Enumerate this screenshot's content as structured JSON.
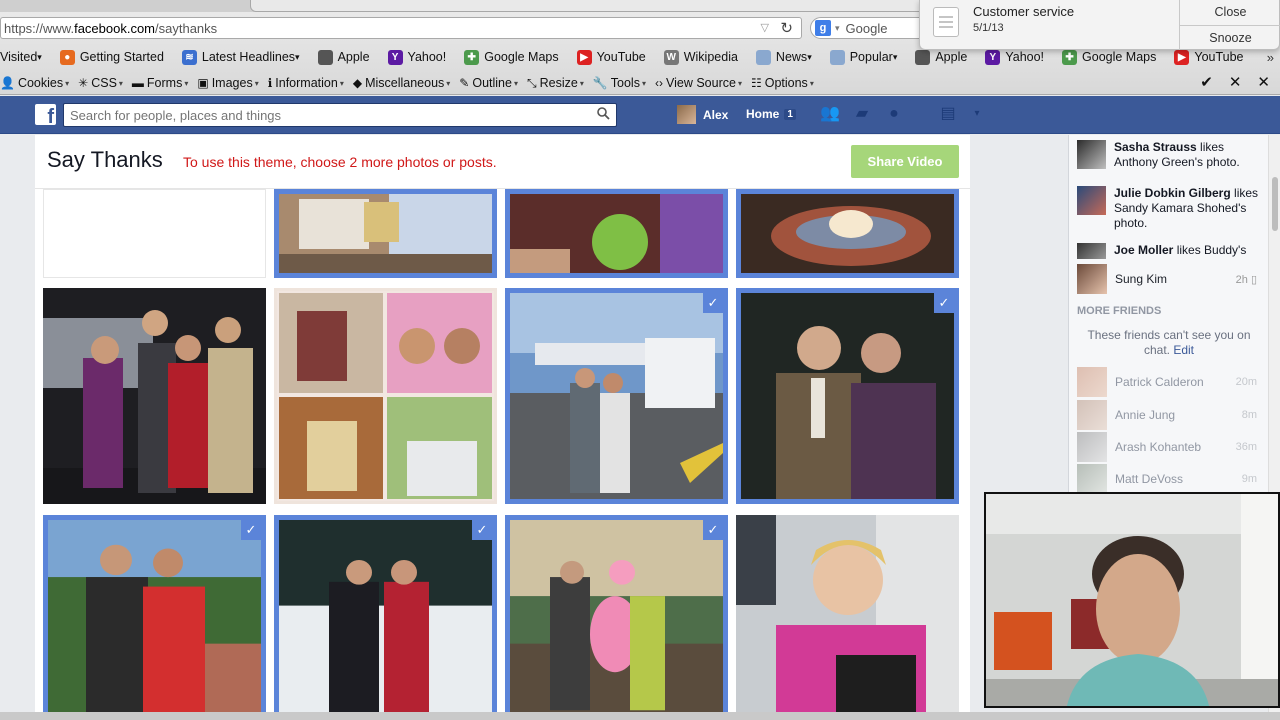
{
  "browser": {
    "url_prefix": "https://www.",
    "url_host": "facebook.com",
    "url_path": "/saythanks",
    "search_placeholder": "Google",
    "bookmarks": [
      {
        "label": "Visited",
        "icon": "none",
        "dropdown": true
      },
      {
        "label": "Getting Started",
        "icon": "firefox-icon",
        "dropdown": false
      },
      {
        "label": "Latest Headlines",
        "icon": "rss-icon",
        "dropdown": true
      },
      {
        "label": "Apple",
        "icon": "apple-icon",
        "dropdown": false
      },
      {
        "label": "Yahoo!",
        "icon": "yahoo-icon",
        "dropdown": false
      },
      {
        "label": "Google Maps",
        "icon": "maps-icon",
        "dropdown": false
      },
      {
        "label": "YouTube",
        "icon": "youtube-icon",
        "dropdown": false
      },
      {
        "label": "Wikipedia",
        "icon": "wikipedia-icon",
        "dropdown": false
      },
      {
        "label": "News",
        "icon": "folder-icon",
        "dropdown": true
      },
      {
        "label": "Popular",
        "icon": "folder-icon",
        "dropdown": true
      },
      {
        "label": "Apple",
        "icon": "apple-icon",
        "dropdown": false
      },
      {
        "label": "Yahoo!",
        "icon": "yahoo-icon",
        "dropdown": false
      },
      {
        "label": "Google Maps",
        "icon": "maps-icon",
        "dropdown": false
      },
      {
        "label": "YouTube",
        "icon": "youtube-icon",
        "dropdown": false
      }
    ],
    "dev_toolbar": [
      {
        "label": "Cookies",
        "icon": "person-icon"
      },
      {
        "label": "CSS",
        "icon": "wand-icon"
      },
      {
        "label": "Forms",
        "icon": "forms-icon"
      },
      {
        "label": "Images",
        "icon": "image-icon"
      },
      {
        "label": "Information",
        "icon": "info-icon"
      },
      {
        "label": "Miscellaneous",
        "icon": "cube-icon"
      },
      {
        "label": "Outline",
        "icon": "pencil-icon"
      },
      {
        "label": "Resize",
        "icon": "resize-icon"
      },
      {
        "label": "Tools",
        "icon": "wrench-icon"
      },
      {
        "label": "View Source",
        "icon": "code-icon"
      },
      {
        "label": "Options",
        "icon": "options-icon"
      }
    ]
  },
  "notification": {
    "title": "Customer service",
    "date": "5/1/13",
    "close_label": "Close",
    "snooze_label": "Snooze"
  },
  "fb": {
    "logo": "f",
    "search_placeholder": "Search for people, places and things",
    "user_name": "Alex",
    "home_label": "Home",
    "home_count": "1"
  },
  "say_thanks": {
    "title": "Say Thanks",
    "hint": "To use this theme, choose 2 more photos or posts.",
    "share_button": "Share Video"
  },
  "ticker": [
    {
      "name": "Sasha Strauss",
      "action": " likes Anthony Green's photo."
    },
    {
      "name": "Julie Dobkin Gilberg",
      "action": " likes Sandy Kamara Shohed's photo."
    },
    {
      "name": "Joe Moller",
      "action": " likes Buddy's"
    }
  ],
  "chat": {
    "online": [
      {
        "name": "Sung Kim",
        "time": "2h"
      }
    ],
    "more_friends_label": "MORE FRIENDS",
    "cant_see_text": "These friends can't see you on chat.",
    "edit_label": "Edit",
    "offline": [
      {
        "name": "Patrick Calderon",
        "time": "20m"
      },
      {
        "name": "Annie Jung",
        "time": "8m"
      },
      {
        "name": "Arash Kohanteb",
        "time": "36m"
      },
      {
        "name": "Matt DeVoss",
        "time": "9m"
      }
    ]
  },
  "colors": {
    "fb_blue": "#3b5998",
    "selection_blue": "#5b84d9",
    "hint_red": "#d01818",
    "share_green": "#a6d67a"
  }
}
